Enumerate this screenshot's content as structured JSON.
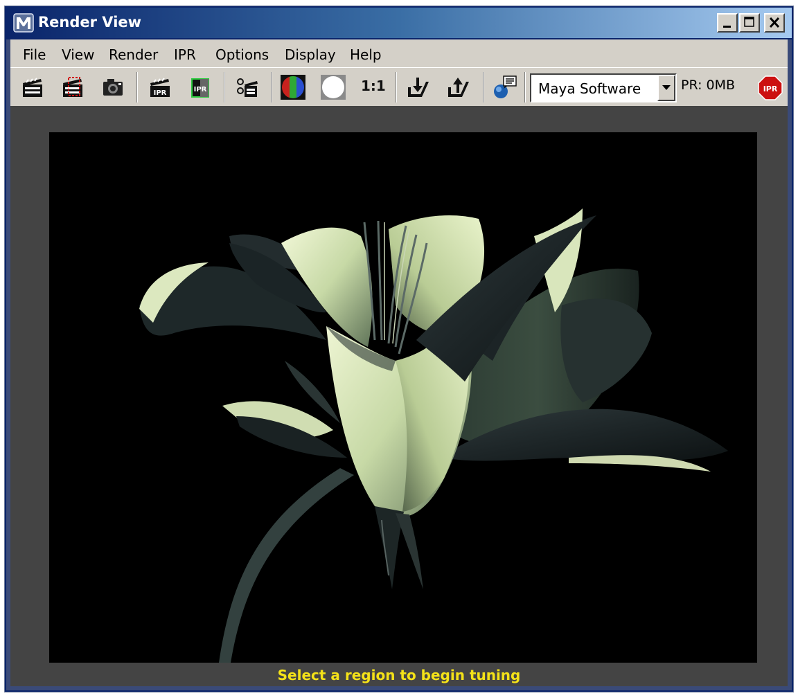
{
  "window": {
    "title": "Render View"
  },
  "menu": {
    "items": [
      "File",
      "View",
      "Render",
      "IPR",
      "Options",
      "Display",
      "Help"
    ]
  },
  "toolbar": {
    "icons": [
      "render-frame-icon",
      "render-region-icon",
      "snapshot-icon",
      "ipr-render-icon",
      "ipr-refresh-icon",
      "render-settings-icon",
      "rgb-channels-icon",
      "alpha-channel-icon",
      "keep-image-icon",
      "remove-image-icon",
      "render-globals-icon",
      "ipr-stop-icon"
    ],
    "ratio_label": "1:1",
    "renderer": {
      "selected": "Maya Software"
    },
    "memory_label": "PR: 0MB"
  },
  "viewport": {
    "background": "#000000",
    "subject": "lily-flower-render"
  },
  "status": {
    "message": "Select a region to begin tuning",
    "color": "#f4e218"
  }
}
